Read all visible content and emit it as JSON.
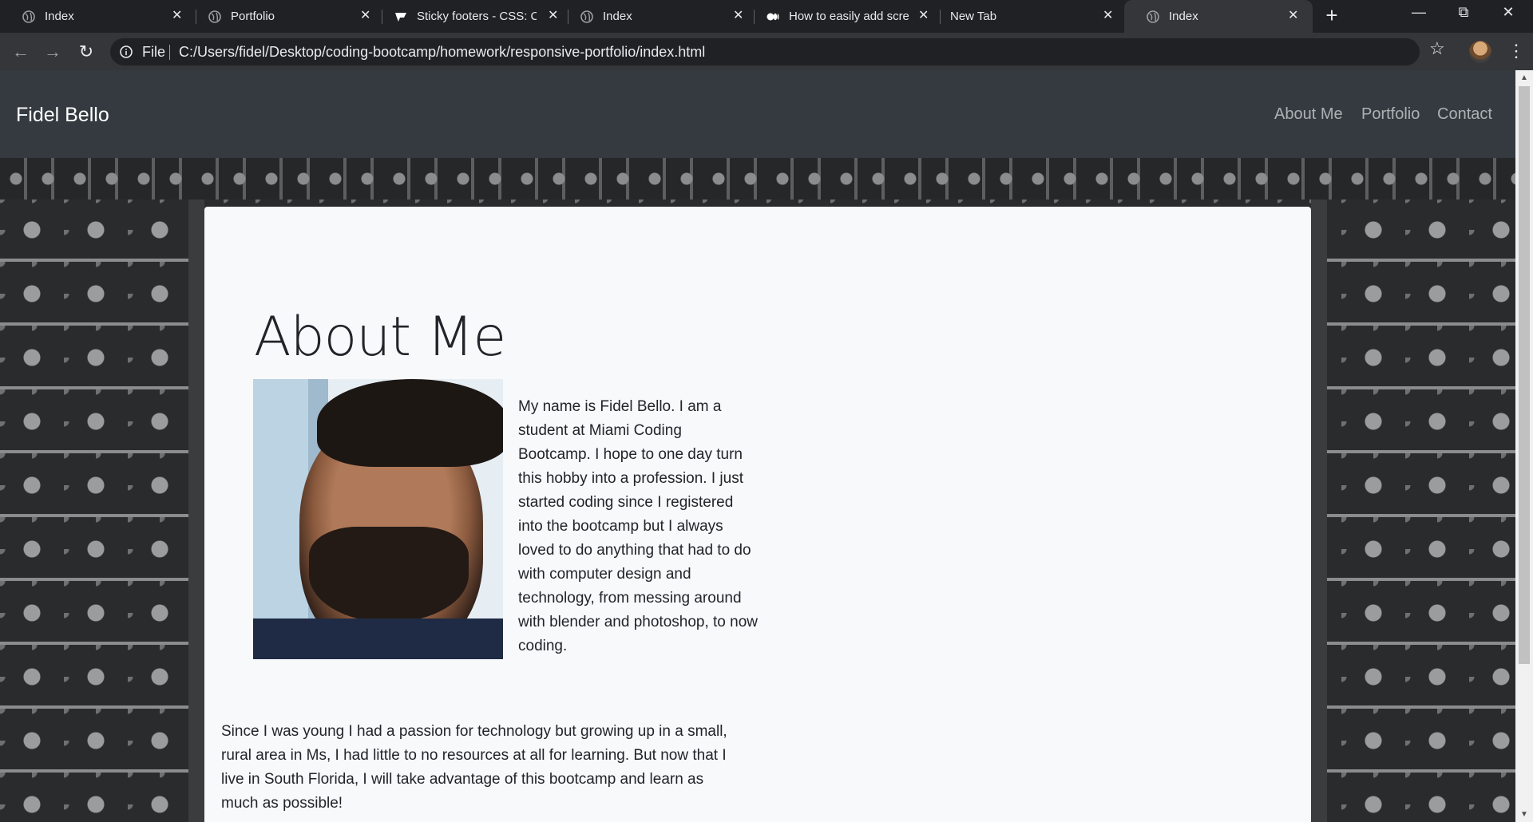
{
  "tabs": [
    {
      "title": "Index",
      "icon": "globe-icon",
      "active": false
    },
    {
      "title": "Portfolio",
      "icon": "globe-icon",
      "active": false
    },
    {
      "title": "Sticky footers - CSS: Ca",
      "icon": "css-tricks-icon",
      "active": false
    },
    {
      "title": "Index",
      "icon": "globe-icon",
      "active": false
    },
    {
      "title": "How to easily add scre",
      "icon": "medium-icon",
      "active": false
    },
    {
      "title": "New Tab",
      "icon": "none",
      "active": false
    },
    {
      "title": "Index",
      "icon": "globe-icon",
      "active": true
    }
  ],
  "toolbar": {
    "scheme_label": "File",
    "url": "C:/Users/fidel/Desktop/coding-bootcamp/homework/responsive-portfolio/index.html"
  },
  "site": {
    "brand": "Fidel Bello",
    "nav": [
      "About Me",
      "Portfolio",
      "Contact"
    ]
  },
  "about": {
    "heading": "About Me",
    "bio": "My name is Fidel Bello. I am a student at Miami Coding Bootcamp. I hope to one day turn this hobby into a profession. I just started coding since I registered into the bootcamp but I always loved to do anything that had to do with computer design and technology, from messing around with blender and photoshop, to now coding.",
    "bio2": "Since I was young I had a passion for technology but growing up in a small, rural area in Ms, I had little to no resources at all for learning. But now that I live in South Florida, I will take advantage of this bootcamp and learn as much as possible!"
  },
  "colors": {
    "navbar": "#343a40",
    "card": "#f8f9fa",
    "chrome_dark": "#202124",
    "chrome_toolbar": "#35363a"
  }
}
